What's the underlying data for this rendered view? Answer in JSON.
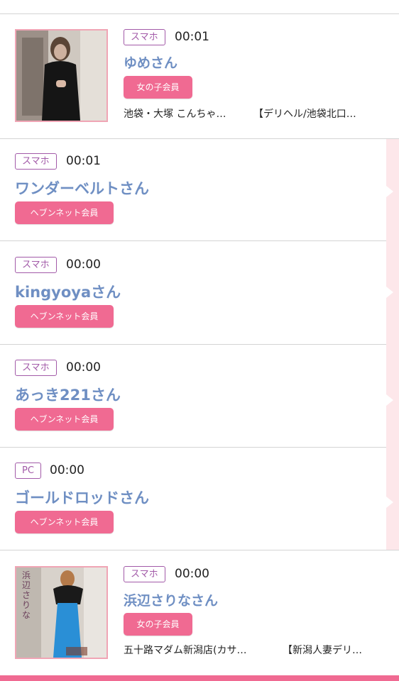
{
  "entries": [
    {
      "device": "スマホ",
      "time": "00:01",
      "name": "ゆめさん",
      "badge": "女の子会員",
      "shop": "池袋・大塚 こんちゃ…",
      "category": "【デリヘル/池袋北口…",
      "photo": "woman-black-dress"
    },
    {
      "device": "スマホ",
      "time": "00:01",
      "name": "ワンダーベルトさん",
      "badge": "ヘブンネット会員"
    },
    {
      "device": "スマホ",
      "time": "00:00",
      "name": "kingyoyaさん",
      "badge": "ヘブンネット会員"
    },
    {
      "device": "スマホ",
      "time": "00:00",
      "name": "あっき221さん",
      "badge": "ヘブンネット会員"
    },
    {
      "device": "PC",
      "time": "00:00",
      "name": "ゴールドロッドさん",
      "badge": "ヘブンネット会員"
    },
    {
      "device": "スマホ",
      "time": "00:00",
      "name": "浜辺さりなさん",
      "badge": "女の子会員",
      "shop": "五十路マダム新潟店(カサ…",
      "category": "【新潟人妻デリ…",
      "photo": "woman-blue-dress",
      "photo_caption": "浜辺さりな"
    }
  ],
  "colors": {
    "accent_pink": "#f06a92",
    "name_blue": "#6f8fc3",
    "tag_purple": "#a25aa8",
    "side_strip": "#fde7ea"
  }
}
